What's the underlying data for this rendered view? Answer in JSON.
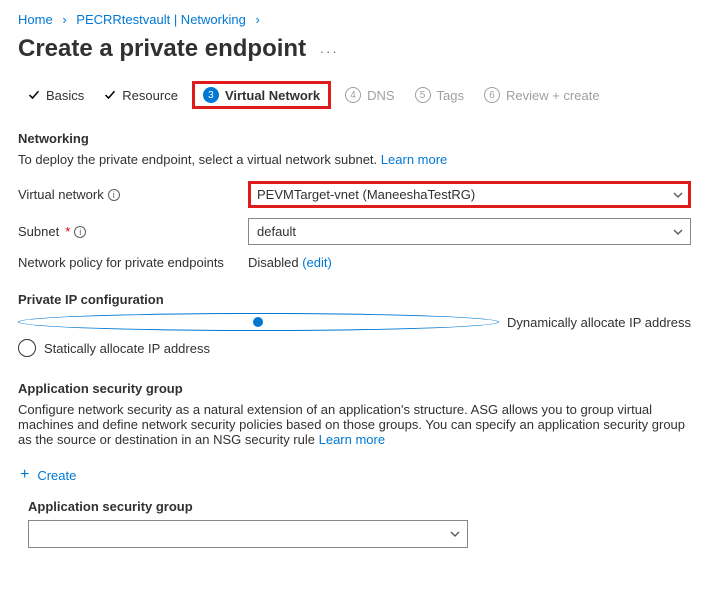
{
  "breadcrumb": {
    "home": "Home",
    "item2": "PECRRtestvault | Networking"
  },
  "title": "Create a private endpoint",
  "tabs": {
    "basics": "Basics",
    "resource": "Resource",
    "virtual_network_num": "3",
    "virtual_network": "Virtual Network",
    "dns_num": "4",
    "dns": "DNS",
    "tags_num": "5",
    "tags": "Tags",
    "review_num": "6",
    "review": "Review + create"
  },
  "networking": {
    "heading": "Networking",
    "desc": "To deploy the private endpoint, select a virtual network subnet.",
    "learn": "Learn more",
    "vnet_label": "Virtual network",
    "vnet_value": "PEVMTarget-vnet (ManeeshaTestRG)",
    "subnet_label": "Subnet",
    "subnet_value": "default",
    "policy_label": "Network policy for private endpoints",
    "policy_value": "Disabled",
    "policy_edit": "(edit)"
  },
  "ipconfig": {
    "heading": "Private IP configuration",
    "dynamic": "Dynamically allocate IP address",
    "static": "Statically allocate IP address"
  },
  "asg": {
    "heading": "Application security group",
    "desc": "Configure network security as a natural extension of an application's structure. ASG allows you to group virtual machines and define network security policies based on those groups. You can specify an application security group as the source or destination in an NSG security rule",
    "learn": "Learn more",
    "create": "Create",
    "sub_label": "Application security group"
  }
}
